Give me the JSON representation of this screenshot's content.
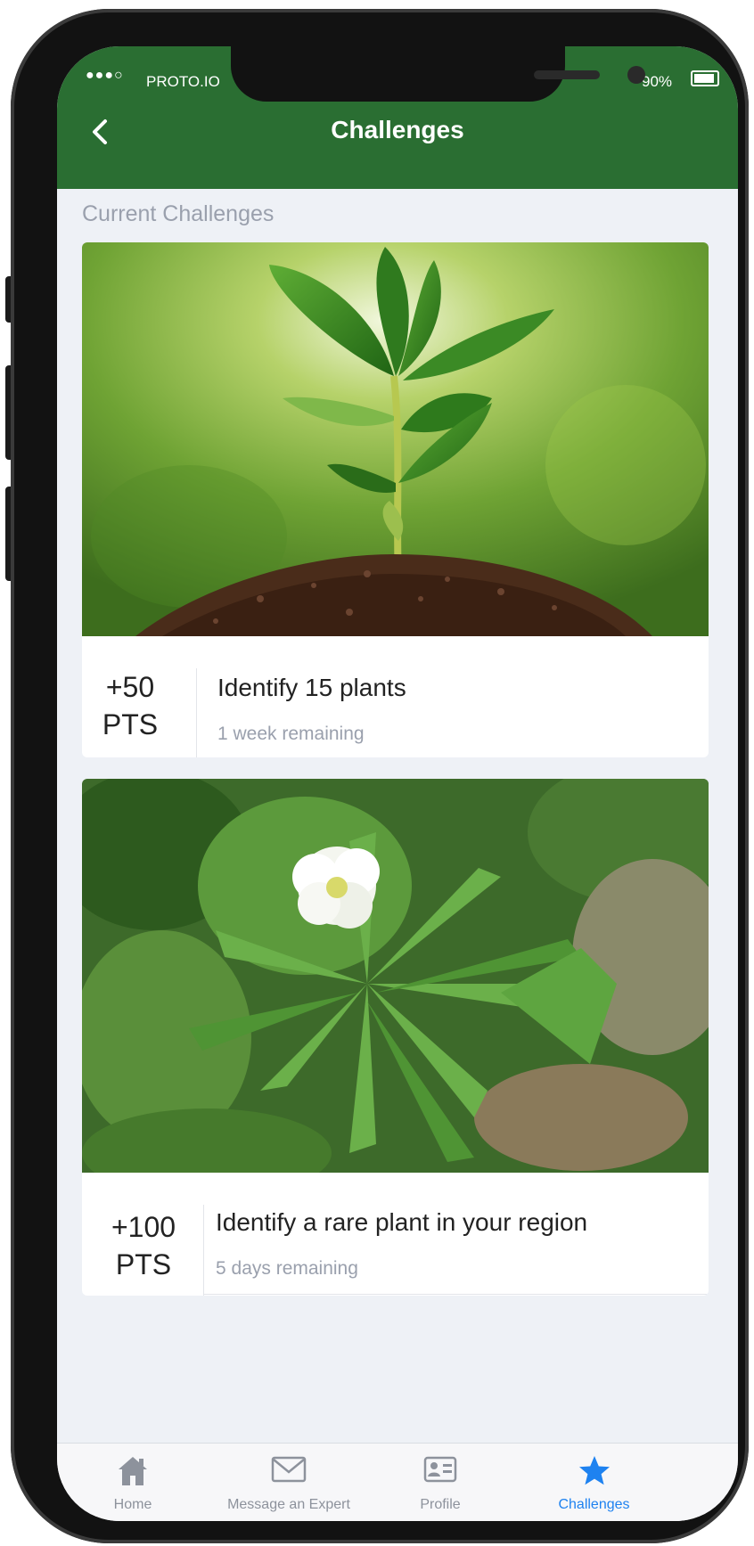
{
  "status_bar": {
    "carrier": "PROTO.IO",
    "battery": "90%"
  },
  "header": {
    "title": "Challenges"
  },
  "section": {
    "label": "Current Challenges"
  },
  "challenges": [
    {
      "points": "+50",
      "points_unit": "PTS",
      "title": "Identify 15 plants",
      "remaining": "1 week remaining"
    },
    {
      "points": "+100",
      "points_unit": "PTS",
      "title": "Identify a rare plant in your region",
      "remaining": "5 days remaining"
    }
  ],
  "tabs": [
    {
      "label": "Home",
      "icon": "home-icon"
    },
    {
      "label": "Message an Expert",
      "icon": "mail-icon"
    },
    {
      "label": "Profile",
      "icon": "profile-card-icon"
    },
    {
      "label": "Challenges",
      "icon": "star-icon",
      "active": true
    }
  ],
  "colors": {
    "header": "#2a6e32",
    "accent": "#1e82f0",
    "background": "#eef1f6"
  }
}
